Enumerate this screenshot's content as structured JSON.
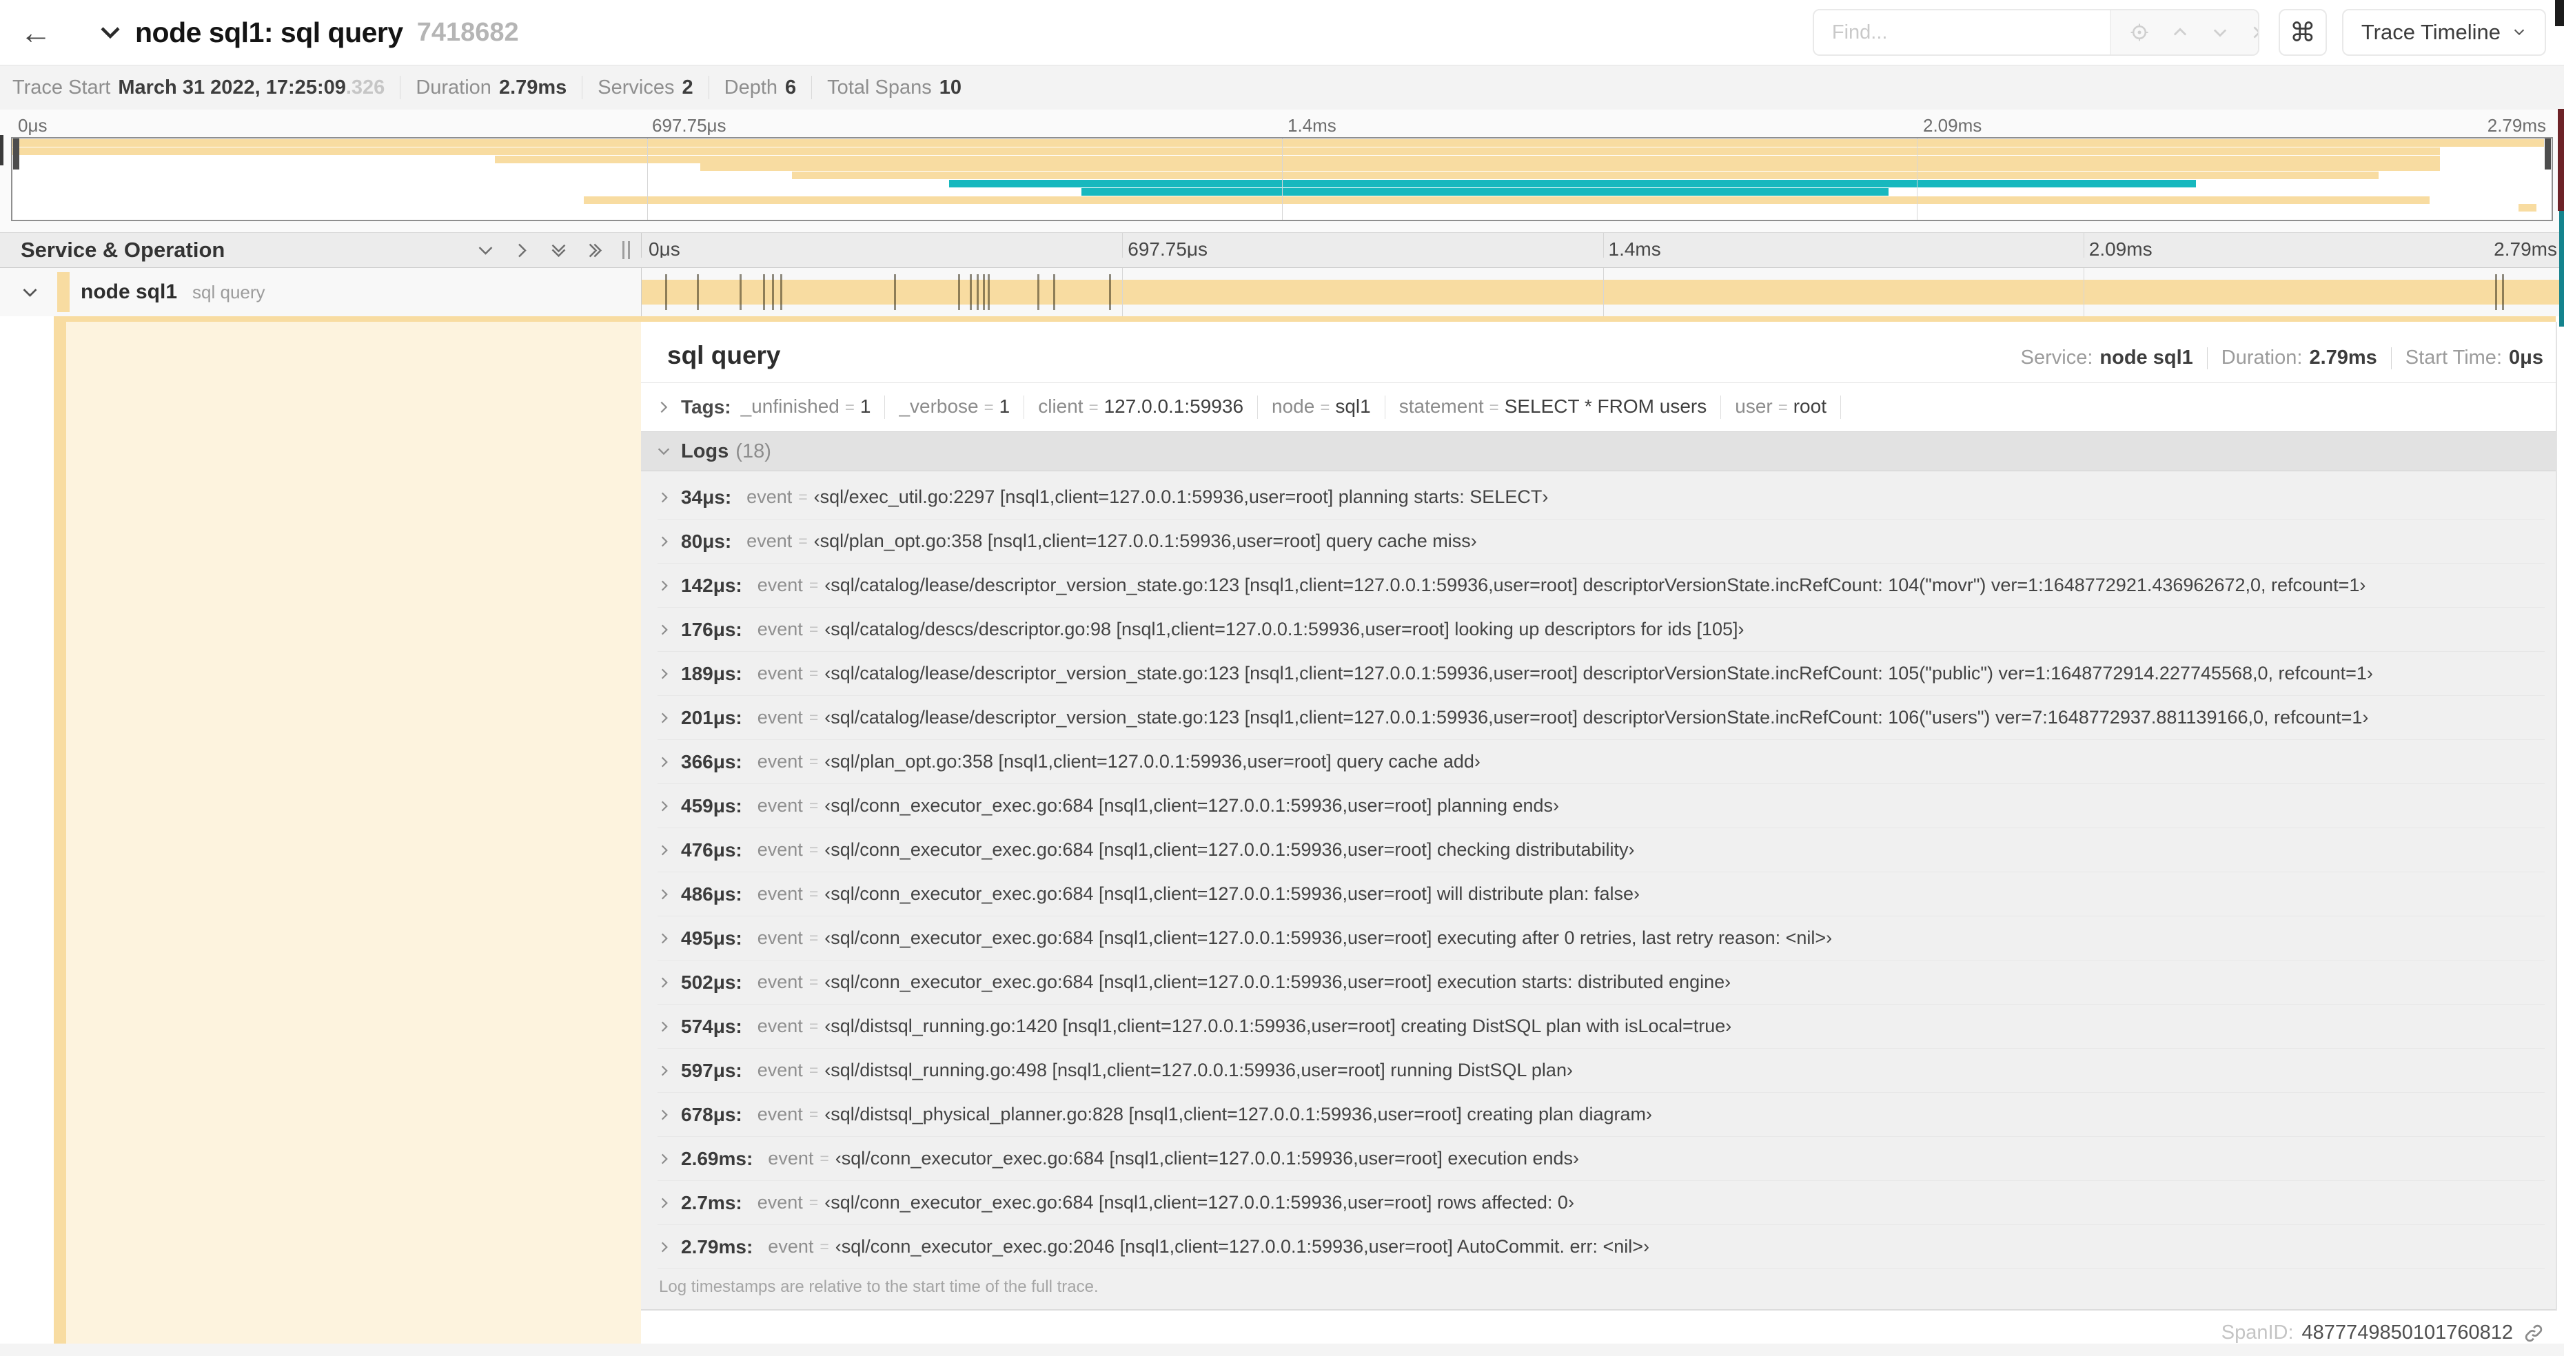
{
  "header": {
    "title": "node sql1: sql query",
    "trace_id": "7418682",
    "find_placeholder": "Find...",
    "shortcut_key": "⌘",
    "view_selector": "Trace Timeline"
  },
  "trace_stats": {
    "trace_start_label": "Trace Start",
    "trace_start_value": "March 31 2022, 17:25:09",
    "trace_start_frac": ".326",
    "duration_label": "Duration",
    "duration_value": "2.79ms",
    "services_label": "Services",
    "services_value": "2",
    "depth_label": "Depth",
    "depth_value": "6",
    "total_spans_label": "Total Spans",
    "total_spans_value": "10"
  },
  "colors": {
    "span_tan": "#F8DCA1",
    "span_teal": "#17B8BE"
  },
  "ruler": {
    "ticks": [
      {
        "label": "0μs",
        "css": "left:0%;padding-left:10px"
      },
      {
        "label": "697.75μs",
        "css": "left:25%;padding-left:8px"
      },
      {
        "label": "1.4ms",
        "css": "left:50%;padding-left:8px"
      },
      {
        "label": "2.09ms",
        "css": "left:75%;padding-left:8px"
      },
      {
        "label": "2.79ms",
        "css": "right:0;padding-right:10px"
      }
    ],
    "gridlines": [
      {
        "css": "left:25%"
      },
      {
        "css": "left:50%"
      },
      {
        "css": "left:75%"
      }
    ]
  },
  "minimap": {
    "spans": [
      {
        "l": 0,
        "w": 99.7,
        "top": 1,
        "color": "#F8DCA1"
      },
      {
        "l": 0,
        "w": 95.6,
        "top": 12.8,
        "color": "#F8DCA1"
      },
      {
        "l": 19.0,
        "w": 76.6,
        "top": 24.6,
        "color": "#F8DCA1"
      },
      {
        "l": 27.1,
        "w": 68.5,
        "top": 36.4,
        "color": "#F8DCA1"
      },
      {
        "l": 30.7,
        "w": 62.5,
        "top": 48.2,
        "color": "#F8DCA1"
      },
      {
        "l": 36.9,
        "w": 49.1,
        "top": 60.0,
        "color": "#17B8BE"
      },
      {
        "l": 42.1,
        "w": 31.8,
        "top": 71.8,
        "color": "#17B8BE"
      },
      {
        "l": 22.5,
        "w": 72.7,
        "top": 83.6,
        "color": "#F8DCA1"
      },
      {
        "l": 98.7,
        "w": 0.7,
        "top": 95.4,
        "color": "#F8DCA1"
      }
    ]
  },
  "timeline": {
    "column_header": "Service & Operation",
    "row": {
      "service": "node sql1",
      "operation": "sql query"
    }
  },
  "detail": {
    "title": "sql query",
    "service_label": "Service:",
    "service_value": "node sql1",
    "duration_label": "Duration:",
    "duration_value": "2.79ms",
    "start_time_label": "Start Time:",
    "start_time_value": "0μs",
    "tags_label": "Tags:",
    "tags": [
      {
        "key": "_unfinished",
        "value": "1"
      },
      {
        "key": "_verbose",
        "value": "1"
      },
      {
        "key": "client",
        "value": "127.0.0.1:59936"
      },
      {
        "key": "node",
        "value": "sql1"
      },
      {
        "key": "statement",
        "value": "SELECT * FROM users"
      },
      {
        "key": "user",
        "value": "root"
      }
    ],
    "logs_label": "Logs",
    "logs_count": "(18)",
    "log_field_name": "event",
    "log_entries": [
      {
        "time": "34μs:",
        "pct": 1.22,
        "field": "event",
        "value": "‹sql/exec_util.go:2297 [nsql1,client=127.0.0.1:59936,user=root] planning starts: SELECT›"
      },
      {
        "time": "80μs:",
        "pct": 2.87,
        "field": "event",
        "value": "‹sql/plan_opt.go:358 [nsql1,client=127.0.0.1:59936,user=root] query cache miss›"
      },
      {
        "time": "142μs:",
        "pct": 5.09,
        "field": "event",
        "value": "‹sql/catalog/lease/descriptor_version_state.go:123 [nsql1,client=127.0.0.1:59936,user=root] descriptorVersionState.incRefCount: 104(\"movr\") ver=1:1648772921.436962672,0, refcount=1›"
      },
      {
        "time": "176μs:",
        "pct": 6.31,
        "field": "event",
        "value": "‹sql/catalog/descs/descriptor.go:98 [nsql1,client=127.0.0.1:59936,user=root] looking up descriptors for ids [105]›"
      },
      {
        "time": "189μs:",
        "pct": 6.77,
        "field": "event",
        "value": "‹sql/catalog/lease/descriptor_version_state.go:123 [nsql1,client=127.0.0.1:59936,user=root] descriptorVersionState.incRefCount: 105(\"public\") ver=1:1648772914.227745568,0, refcount=1›"
      },
      {
        "time": "201μs:",
        "pct": 7.2,
        "field": "event",
        "value": "‹sql/catalog/lease/descriptor_version_state.go:123 [nsql1,client=127.0.0.1:59936,user=root] descriptorVersionState.incRefCount: 106(\"users\") ver=7:1648772937.881139166,0, refcount=1›"
      },
      {
        "time": "366μs:",
        "pct": 13.12,
        "field": "event",
        "value": "‹sql/plan_opt.go:358 [nsql1,client=127.0.0.1:59936,user=root] query cache add›"
      },
      {
        "time": "459μs:",
        "pct": 16.45,
        "field": "event",
        "value": "‹sql/conn_executor_exec.go:684 [nsql1,client=127.0.0.1:59936,user=root] planning ends›"
      },
      {
        "time": "476μs:",
        "pct": 17.06,
        "field": "event",
        "value": "‹sql/conn_executor_exec.go:684 [nsql1,client=127.0.0.1:59936,user=root] checking distributability›"
      },
      {
        "time": "486μs:",
        "pct": 17.42,
        "field": "event",
        "value": "‹sql/conn_executor_exec.go:684 [nsql1,client=127.0.0.1:59936,user=root] will distribute plan: false›"
      },
      {
        "time": "495μs:",
        "pct": 17.74,
        "field": "event",
        "value": "‹sql/conn_executor_exec.go:684 [nsql1,client=127.0.0.1:59936,user=root] executing after 0 retries, last retry reason: <nil>›"
      },
      {
        "time": "502μs:",
        "pct": 17.99,
        "field": "event",
        "value": "‹sql/conn_executor_exec.go:684 [nsql1,client=127.0.0.1:59936,user=root] execution starts: distributed engine›"
      },
      {
        "time": "574μs:",
        "pct": 20.57,
        "field": "event",
        "value": "‹sql/distsql_running.go:1420 [nsql1,client=127.0.0.1:59936,user=root] creating DistSQL plan with isLocal=true›"
      },
      {
        "time": "597μs:",
        "pct": 21.4,
        "field": "event",
        "value": "‹sql/distsql_running.go:498 [nsql1,client=127.0.0.1:59936,user=root] running DistSQL plan›"
      },
      {
        "time": "678μs:",
        "pct": 24.3,
        "field": "event",
        "value": "‹sql/distsql_physical_planner.go:828 [nsql1,client=127.0.0.1:59936,user=root] creating plan diagram›"
      },
      {
        "time": "2.69ms:",
        "pct": 96.42,
        "field": "event",
        "value": "‹sql/conn_executor_exec.go:684 [nsql1,client=127.0.0.1:59936,user=root] execution ends›"
      },
      {
        "time": "2.7ms:",
        "pct": 96.77,
        "field": "event",
        "value": "‹sql/conn_executor_exec.go:684 [nsql1,client=127.0.0.1:59936,user=root] rows affected: 0›"
      },
      {
        "time": "2.79ms:",
        "pct": 99.95,
        "field": "event",
        "value": "‹sql/conn_executor_exec.go:2046 [nsql1,client=127.0.0.1:59936,user=root] AutoCommit. err: <nil>›"
      }
    ],
    "logs_footer": "Log timestamps are relative to the start time of the full trace.",
    "span_id_label": "SpanID:",
    "span_id_value": "4877749850101760812"
  }
}
